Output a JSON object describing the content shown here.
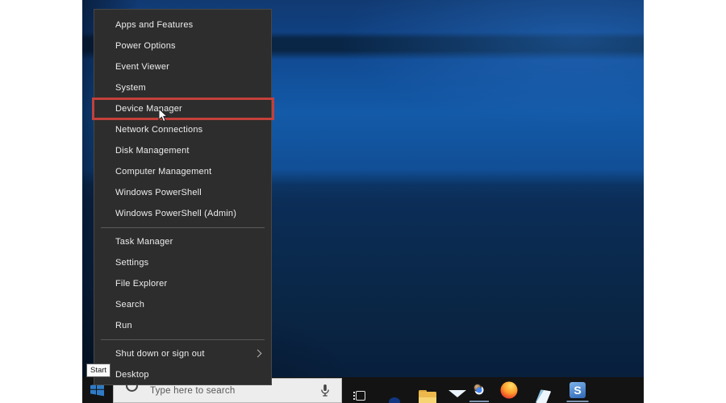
{
  "context_menu": {
    "items": [
      {
        "label": "Apps and Features"
      },
      {
        "label": "Power Options"
      },
      {
        "label": "Event Viewer"
      },
      {
        "label": "System"
      },
      {
        "label": "Device Manager",
        "highlighted": true
      },
      {
        "label": "Network Connections"
      },
      {
        "label": "Disk Management"
      },
      {
        "label": "Computer Management"
      },
      {
        "label": "Windows PowerShell"
      },
      {
        "label": "Windows PowerShell (Admin)"
      },
      {
        "label": "Task Manager"
      },
      {
        "label": "Settings"
      },
      {
        "label": "File Explorer"
      },
      {
        "label": "Search"
      },
      {
        "label": "Run"
      },
      {
        "label": "Shut down or sign out",
        "has_submenu": true
      },
      {
        "label": "Desktop"
      }
    ],
    "highlight_color": "#c4403b"
  },
  "tooltip": {
    "text": "Start"
  },
  "taskbar": {
    "search_placeholder": "Type here to search",
    "apps": [
      {
        "name": "task-view",
        "running": false
      },
      {
        "name": "microsoft-edge",
        "running": false
      },
      {
        "name": "file-explorer",
        "running": false
      },
      {
        "name": "mail",
        "running": false
      },
      {
        "name": "google-chrome",
        "running": true
      },
      {
        "name": "firefox",
        "running": false
      },
      {
        "name": "notepad",
        "running": false
      },
      {
        "name": "snagit",
        "running": true,
        "letter": "S"
      }
    ]
  },
  "colors": {
    "menu_background": "#2d2d2d",
    "menu_text": "#ededed",
    "highlight_red": "#c4403b",
    "taskbar": "#131313",
    "wallpaper_bright_blue": "#135aa8",
    "wallpaper_dark_blue": "#0a2645",
    "search_box": "#ededed"
  }
}
